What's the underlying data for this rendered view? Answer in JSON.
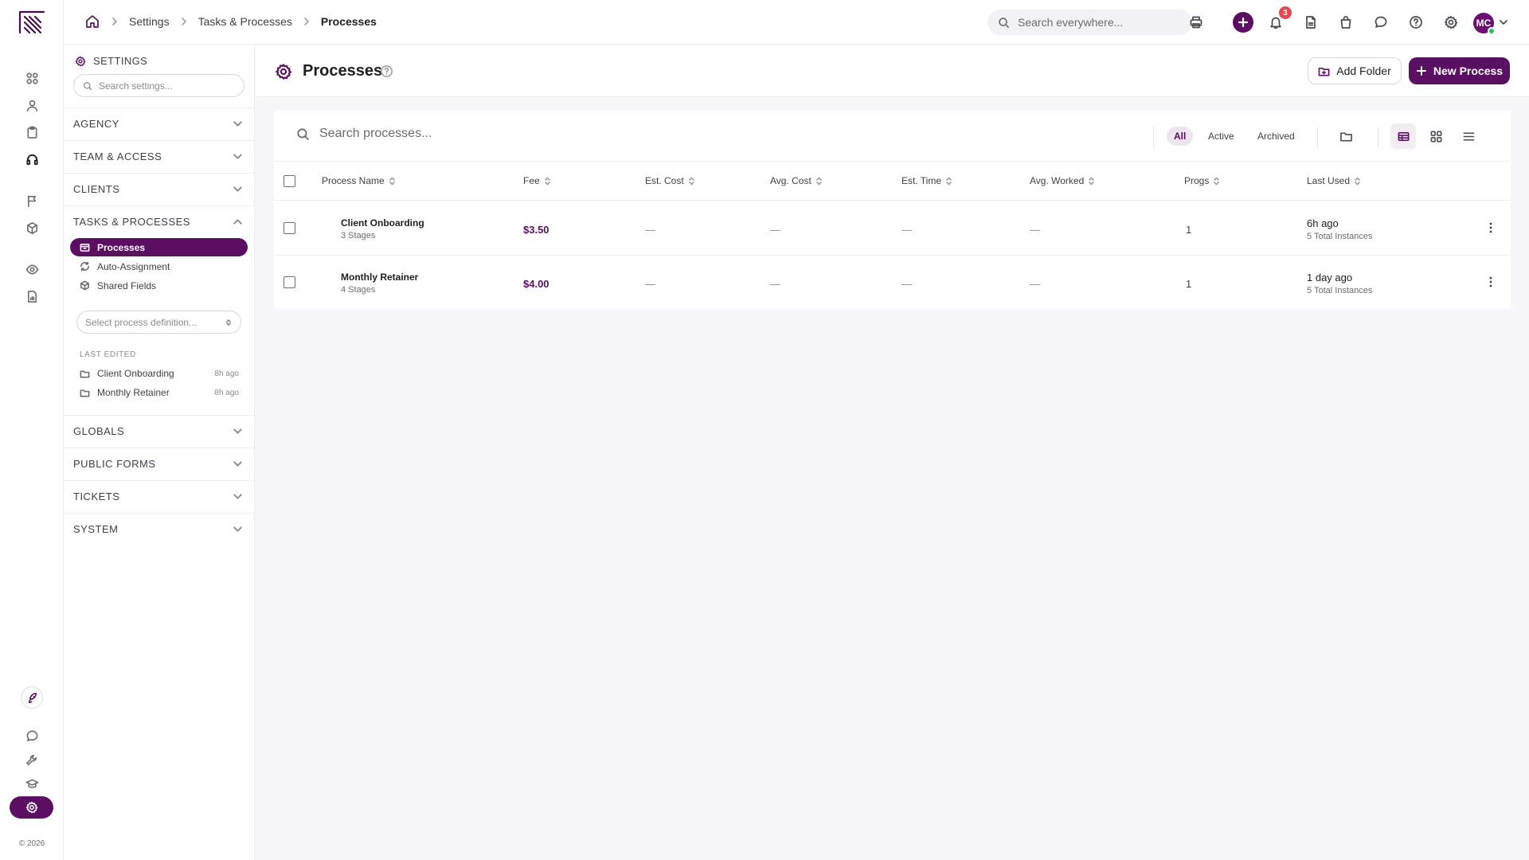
{
  "rail": {
    "copyright": "© 2026"
  },
  "topbar": {
    "breadcrumb": [
      "Settings",
      "Tasks & Processes",
      "Processes"
    ],
    "search_placeholder": "Search everywhere...",
    "notifications_count": "3",
    "avatar_initials": "MC"
  },
  "settings_panel": {
    "header": "SETTINGS",
    "search_placeholder": "Search settings...",
    "sections": [
      "AGENCY",
      "TEAM & ACCESS",
      "CLIENTS",
      "TASKS & PROCESSES",
      "GLOBALS",
      "PUBLIC FORMS",
      "TICKETS",
      "SYSTEM"
    ],
    "tasks_items": [
      "Processes",
      "Auto-Assignment",
      "Shared Fields"
    ],
    "process_select_placeholder": "Select process definition...",
    "last_edited_label": "LAST EDITED",
    "last_edited": [
      {
        "name": "Client Onboarding",
        "ago": "8h ago"
      },
      {
        "name": "Monthly Retainer",
        "ago": "8h ago"
      }
    ]
  },
  "page": {
    "title": "Processes",
    "add_folder_label": "Add Folder",
    "new_process_label": "New Process"
  },
  "toolbar": {
    "search_placeholder": "Search processes...",
    "filters": [
      "All",
      "Active",
      "Archived"
    ],
    "active_filter": "All"
  },
  "table": {
    "columns": [
      "Process Name",
      "Fee",
      "Est. Cost",
      "Avg. Cost",
      "Est. Time",
      "Avg. Worked",
      "Progs",
      "Last Used"
    ],
    "rows": [
      {
        "name": "Client Onboarding",
        "stages": "3 Stages",
        "fee": "$3.50",
        "est_cost": "—",
        "avg_cost": "—",
        "est_time": "—",
        "avg_worked": "—",
        "progs": "1",
        "last_used": "6h ago",
        "instances": "5 Total Instances"
      },
      {
        "name": "Monthly Retainer",
        "stages": "4 Stages",
        "fee": "$4.00",
        "est_cost": "—",
        "avg_cost": "—",
        "est_time": "—",
        "avg_worked": "—",
        "progs": "1",
        "last_used": "1 day ago",
        "instances": "5 Total Instances"
      }
    ]
  },
  "colors": {
    "brand": "#5b0f63",
    "badge": "#e5484d",
    "online": "#22c55e"
  }
}
